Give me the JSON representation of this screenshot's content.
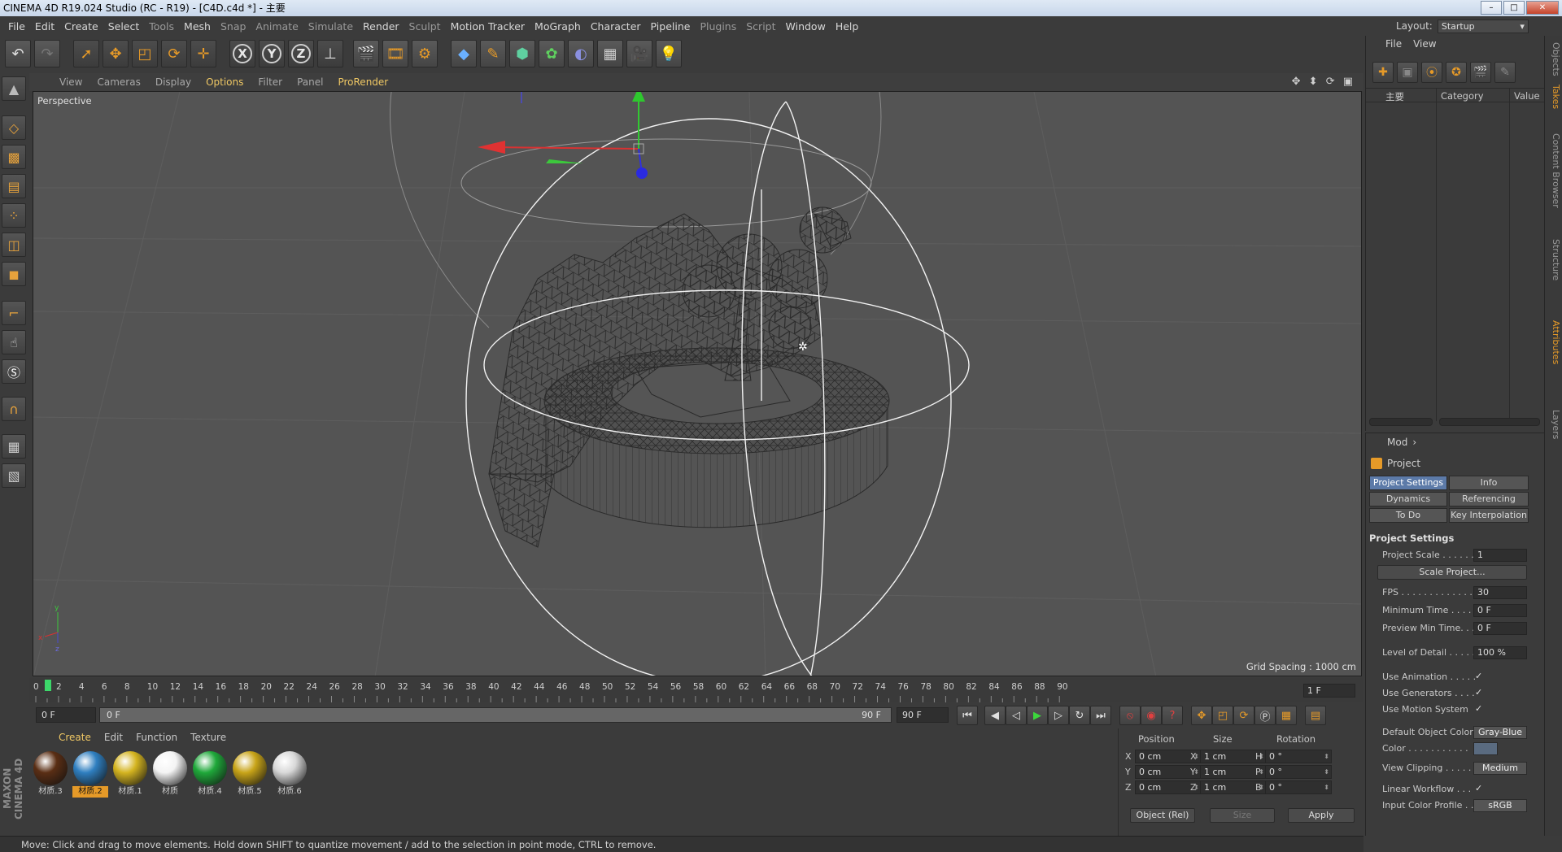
{
  "window": {
    "title": "CINEMA 4D R19.024 Studio (RC - R19) - [C4D.c4d *] - 主要"
  },
  "menubar": {
    "items": [
      {
        "label": "File",
        "dim": false
      },
      {
        "label": "Edit",
        "dim": false
      },
      {
        "label": "Create",
        "dim": false
      },
      {
        "label": "Select",
        "dim": false
      },
      {
        "label": "Tools",
        "dim": true
      },
      {
        "label": "Mesh",
        "dim": false
      },
      {
        "label": "Snap",
        "dim": true
      },
      {
        "label": "Animate",
        "dim": true
      },
      {
        "label": "Simulate",
        "dim": true
      },
      {
        "label": "Render",
        "dim": false
      },
      {
        "label": "Sculpt",
        "dim": true
      },
      {
        "label": "Motion Tracker",
        "dim": false
      },
      {
        "label": "MoGraph",
        "dim": false
      },
      {
        "label": "Character",
        "dim": false
      },
      {
        "label": "Pipeline",
        "dim": false
      },
      {
        "label": "Plugins",
        "dim": true
      },
      {
        "label": "Script",
        "dim": true
      },
      {
        "label": "Window",
        "dim": false
      },
      {
        "label": "Help",
        "dim": false
      }
    ]
  },
  "layout": {
    "label": "Layout:",
    "value": "Startup"
  },
  "toolbar": {
    "icons": [
      "undo-icon",
      "redo-icon",
      "live-selection-icon",
      "move-icon",
      "scale-icon",
      "rotate-icon",
      "move-plus-icon",
      "x-axis-lock-icon",
      "y-axis-lock-icon",
      "z-axis-lock-icon",
      "coordinate-system-icon",
      "render-view-icon",
      "render-picture-viewer-icon",
      "render-settings-icon",
      "cube-icon",
      "pen-icon",
      "subdivision-icon",
      "cloner-icon",
      "deformer-icon",
      "floor-icon",
      "camera-icon",
      "light-icon"
    ],
    "axis_labels": {
      "x": "X",
      "y": "Y",
      "z": "Z"
    }
  },
  "viewport": {
    "menu": [
      {
        "label": "View",
        "hi": false
      },
      {
        "label": "Cameras",
        "hi": false
      },
      {
        "label": "Display",
        "hi": false
      },
      {
        "label": "Options",
        "hi": true
      },
      {
        "label": "Filter",
        "hi": false
      },
      {
        "label": "Panel",
        "hi": false
      },
      {
        "label": "ProRender",
        "hi": true
      }
    ],
    "nav_icons": "✥ ⬍ ⟳ ▣",
    "label": "Perspective",
    "grid_spacing": "Grid Spacing : 1000 cm",
    "axis_x": "x",
    "axis_y": "y",
    "axis_z": "z"
  },
  "timeline": {
    "ticks": [
      "0",
      "2",
      "4",
      "6",
      "8",
      "10",
      "12",
      "14",
      "16",
      "18",
      "20",
      "22",
      "24",
      "26",
      "28",
      "30",
      "32",
      "34",
      "36",
      "38",
      "40",
      "42",
      "44",
      "46",
      "48",
      "50",
      "52",
      "54",
      "56",
      "58",
      "60",
      "62",
      "64",
      "66",
      "68",
      "70",
      "72",
      "74",
      "76",
      "78",
      "80",
      "82",
      "84",
      "86",
      "88",
      "90"
    ],
    "current_frame": "1 F"
  },
  "transport": {
    "start_field": "0 F",
    "range_start": "0 F",
    "range_end": "90 F",
    "end_field": "90 F"
  },
  "materials": {
    "menu": [
      {
        "label": "Create",
        "hi": true
      },
      {
        "label": "Edit",
        "hi": false
      },
      {
        "label": "Function",
        "hi": false
      },
      {
        "label": "Texture",
        "hi": false
      }
    ],
    "items": [
      {
        "name": "材质.3",
        "color": "#5a2e14",
        "selected": false
      },
      {
        "name": "材质.2",
        "color": "#2f7fc0",
        "selected": true
      },
      {
        "name": "材质.1",
        "color": "#d4b420",
        "selected": false
      },
      {
        "name": "材质",
        "color": "#f4f4f4",
        "selected": false
      },
      {
        "name": "材质.4",
        "color": "#1fa83a",
        "selected": false
      },
      {
        "name": "材质.5",
        "color": "#c8a418",
        "selected": false
      },
      {
        "name": "材质.6",
        "color": "#d8d8d8",
        "selected": false
      }
    ],
    "logo": "MAXON CINEMA 4D"
  },
  "coords": {
    "headers": {
      "position": "Position",
      "size": "Size",
      "rotation": "Rotation"
    },
    "rows": [
      {
        "pa": "X",
        "pv": "0 cm",
        "sa": "X",
        "sv": "1 cm",
        "ra": "H",
        "rv": "0 °"
      },
      {
        "pa": "Y",
        "pv": "0 cm",
        "sa": "Y",
        "sv": "1 cm",
        "ra": "P",
        "rv": "0 °"
      },
      {
        "pa": "Z",
        "pv": "0 cm",
        "sa": "Z",
        "sv": "1 cm",
        "ra": "B",
        "rv": "0 °"
      }
    ],
    "mode": "Object (Rel)",
    "size_mode": "Size",
    "apply": "Apply"
  },
  "statusbar": {
    "text": "Move: Click and drag to move elements. Hold down SHIFT to quantize movement / add to the selection in point mode, CTRL to remove."
  },
  "object_manager": {
    "menu": [
      "File",
      "View"
    ],
    "col_name": "主要",
    "col_category": "Category",
    "col_value": "Value"
  },
  "side_tabs": [
    {
      "label": "Objects",
      "hi": false
    },
    {
      "label": "Takes",
      "hi": true
    },
    {
      "label": "Content Browser",
      "hi": false
    },
    {
      "label": "Structure",
      "hi": false
    },
    {
      "label": "Attributes",
      "hi": true
    },
    {
      "label": "Layers",
      "hi": false
    }
  ],
  "attributes": {
    "menu": "Mod",
    "title": "Project",
    "tabs": [
      {
        "label": "Project Settings",
        "selected": true
      },
      {
        "label": "Info",
        "selected": false
      },
      {
        "label": "Dynamics",
        "selected": false
      },
      {
        "label": "Referencing",
        "selected": false
      },
      {
        "label": "To Do",
        "selected": false
      },
      {
        "label": "Key Interpolation",
        "selected": false
      }
    ],
    "section": "Project Settings",
    "project_scale_label": "Project Scale . . . . . .",
    "project_scale": "1",
    "scale_project_btn": "Scale Project...",
    "fps_label": "FPS . . . . . . . . . . . . . .",
    "fps": "30",
    "min_time_label": "Minimum Time . . . . .",
    "min_time": "0 F",
    "preview_min_label": "Preview Min Time. . .",
    "preview_min": "0 F",
    "lod_label": "Level of Detail . . . . .",
    "lod": "100 %",
    "use_animation_label": "Use Animation . . . . .",
    "use_generators_label": "Use Generators . . . .",
    "use_motion_label": "Use Motion System",
    "check": "✓",
    "default_obj_color_label": "Default Object Color",
    "default_obj_color": "Gray-Blue",
    "color_label": "Color . . . . . . . . . . .",
    "view_clipping_label": "View Clipping . . . . .",
    "view_clipping": "Medium",
    "linear_workflow_label": "Linear Workflow . . .",
    "input_color_profile_label": "Input Color Profile . .",
    "input_color_profile": "sRGB"
  }
}
